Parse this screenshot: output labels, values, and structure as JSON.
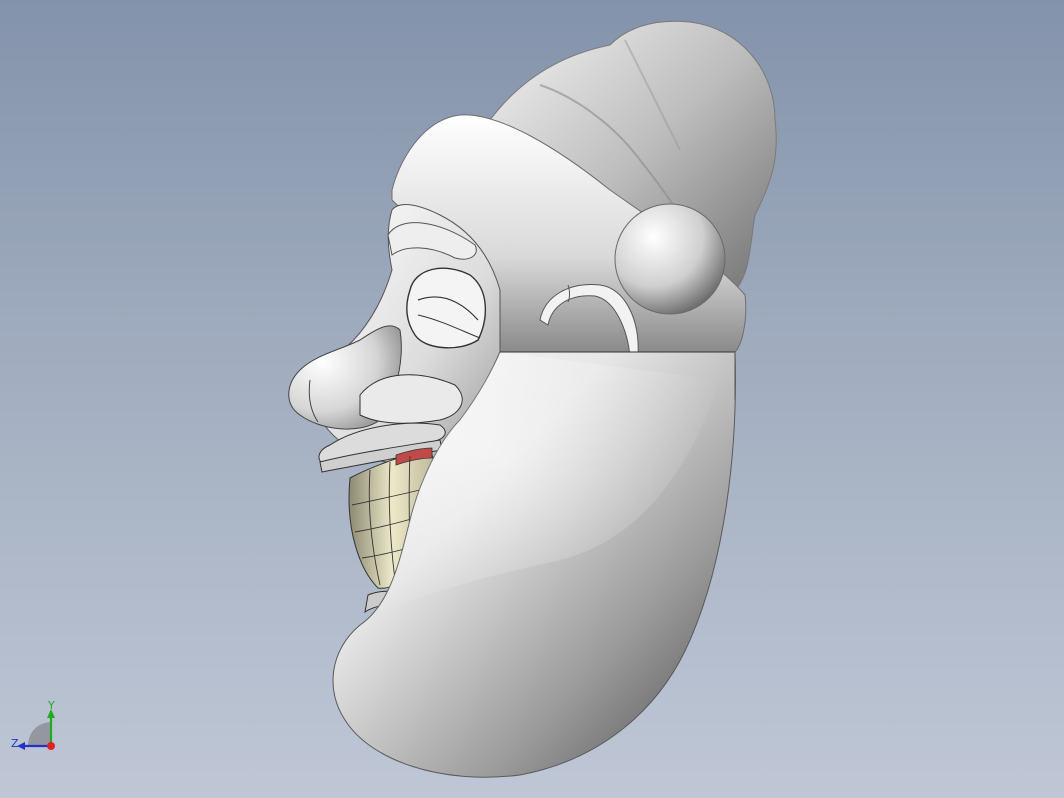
{
  "viewport": {
    "background_top": "#8393ab",
    "background_bottom": "#bfc7d6"
  },
  "model": {
    "subject": "santa-head-side-view"
  },
  "triad": {
    "y_label": "Y",
    "z_label": "Z",
    "y_color": "#22aa22",
    "z_color": "#2233cc",
    "x_color": "#dd2222"
  }
}
